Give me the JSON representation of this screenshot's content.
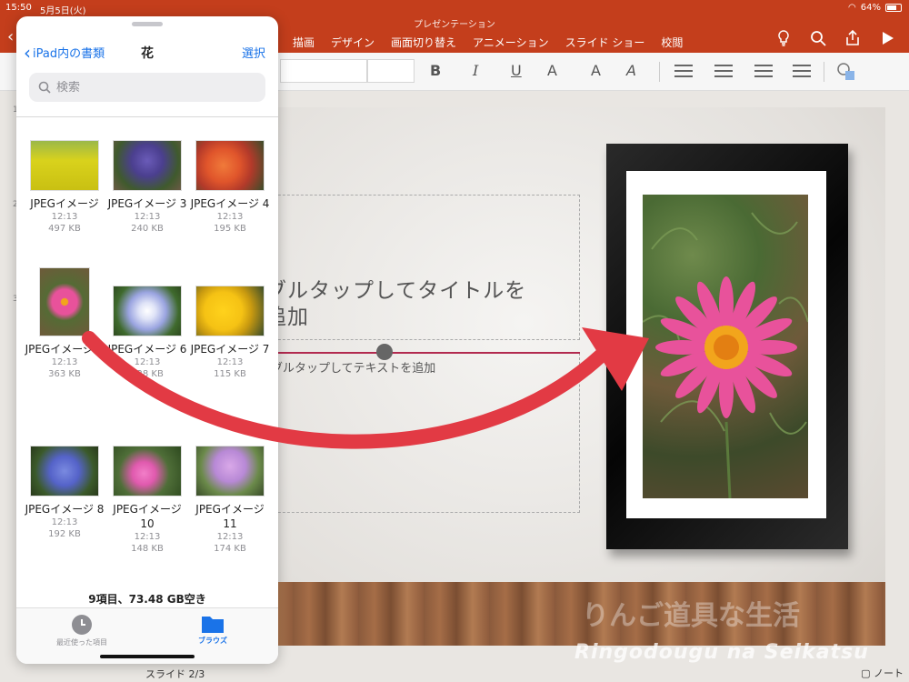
{
  "status": {
    "time": "15:50",
    "date": "5月5日(火)",
    "battery": "64%"
  },
  "app": {
    "title": "プレゼンテーション"
  },
  "ribbon": {
    "tabs": [
      "描画",
      "デザイン",
      "画面切り替え",
      "アニメーション",
      "スライド ショー",
      "校閲"
    ],
    "icons": [
      "lightbulb-icon",
      "search-icon",
      "share-icon",
      "play-icon"
    ]
  },
  "format": {
    "bold": "B",
    "italic": "I",
    "underline": "U",
    "text_effect": "A",
    "font_color_label": "A",
    "font_color": "#e0282e",
    "highlight_label": "A"
  },
  "slide": {
    "title_placeholder": "ブルタップしてタイトルを追加",
    "title_line1": "ブルタップしてタイトルを",
    "title_line2": "追加",
    "body_placeholder": "ブルタップしてテキストを追加",
    "thumb_numbers": [
      "1",
      "2",
      "3"
    ]
  },
  "footer": {
    "slide_counter": "スライド 2/3",
    "notes": "ノート"
  },
  "watermark": "Ringodougu na Seikatsu",
  "files": {
    "back_label": "iPad内の書類",
    "title": "花",
    "select_label": "選択",
    "search_placeholder": "検索",
    "items": [
      {
        "name": "JPEGイメージ",
        "time": "12:13",
        "size": "497 KB",
        "thumb": "yellow-field"
      },
      {
        "name": "JPEGイメージ 3",
        "time": "12:13",
        "size": "240 KB",
        "thumb": "purple-flowers"
      },
      {
        "name": "JPEGイメージ 4",
        "time": "12:13",
        "size": "195 KB",
        "thumb": "orange-flowers"
      },
      {
        "name": "JPEGイメージ 5",
        "time": "12:13",
        "size": "363 KB",
        "thumb": "pink-daisy"
      },
      {
        "name": "JPEGイメージ 6",
        "time": "12:13",
        "size": "128 KB",
        "thumb": "blue-star"
      },
      {
        "name": "JPEGイメージ 7",
        "time": "12:13",
        "size": "115 KB",
        "thumb": "yellow-pansy"
      },
      {
        "name": "JPEGイメージ 8",
        "time": "12:13",
        "size": "192 KB",
        "thumb": "blue-hydrangea"
      },
      {
        "name": "JPEGイメージ 10",
        "time": "12:13",
        "size": "148 KB",
        "thumb": "pink-small"
      },
      {
        "name": "JPEGイメージ 11",
        "time": "12:13",
        "size": "174 KB",
        "thumb": "lilac-hydrangea"
      }
    ],
    "summary": "9項目、73.48 GB空き",
    "tabs": {
      "recent": "最近使った項目",
      "browse": "ブラウズ"
    }
  },
  "colors": {
    "ribbon": "#c43e1c",
    "accent_blue": "#1a73e8",
    "arrow": "#e23a44",
    "pink_flower": "#e8529b"
  }
}
